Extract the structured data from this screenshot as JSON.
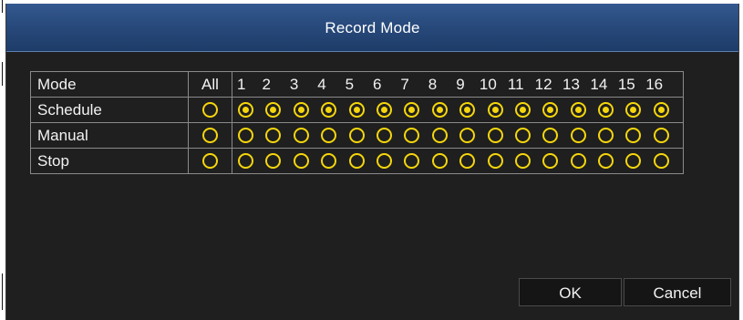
{
  "dialog": {
    "title": "Record Mode"
  },
  "grid": {
    "header": {
      "mode": "Mode",
      "all": "All",
      "channels": [
        "1",
        "2",
        "3",
        "4",
        "5",
        "6",
        "7",
        "8",
        "9",
        "10",
        "11",
        "12",
        "13",
        "14",
        "15",
        "16"
      ]
    },
    "rows": [
      {
        "label": "Schedule",
        "all_selected": false,
        "channels_selected": [
          true,
          true,
          true,
          true,
          true,
          true,
          true,
          true,
          true,
          true,
          true,
          true,
          true,
          true,
          true,
          true
        ]
      },
      {
        "label": "Manual",
        "all_selected": false,
        "channels_selected": [
          false,
          false,
          false,
          false,
          false,
          false,
          false,
          false,
          false,
          false,
          false,
          false,
          false,
          false,
          false,
          false
        ]
      },
      {
        "label": "Stop",
        "all_selected": false,
        "channels_selected": [
          false,
          false,
          false,
          false,
          false,
          false,
          false,
          false,
          false,
          false,
          false,
          false,
          false,
          false,
          false,
          false
        ]
      }
    ]
  },
  "buttons": {
    "ok": "OK",
    "cancel": "Cancel"
  },
  "colors": {
    "title_bar": "#284a7c",
    "radio": "#f5d60c",
    "background": "#1f1f1f"
  }
}
